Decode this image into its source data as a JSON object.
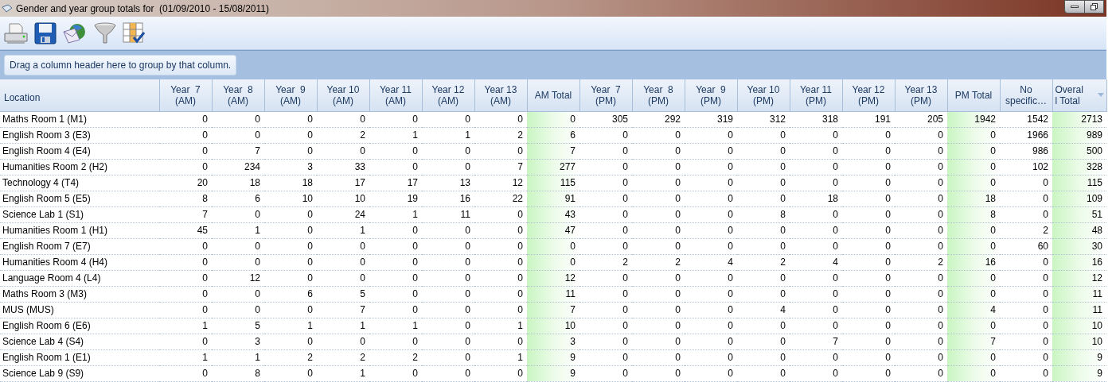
{
  "window": {
    "title": "Gender and year group totals for  (01/09/2010 - 15/08/2011)"
  },
  "toolbar": [
    {
      "kind": "print"
    },
    {
      "kind": "save"
    },
    {
      "kind": "email"
    },
    {
      "kind": "filter"
    },
    {
      "kind": "columns"
    }
  ],
  "group_panel": {
    "hint": "Drag a column header here to group by that column."
  },
  "table": {
    "columns": [
      {
        "lines": [
          "Location"
        ],
        "kind": "text"
      },
      {
        "lines": [
          "Year  7",
          "(AM)"
        ],
        "kind": "count"
      },
      {
        "lines": [
          "Year  8",
          "(AM)"
        ],
        "kind": "count"
      },
      {
        "lines": [
          "Year  9",
          "(AM)"
        ],
        "kind": "count"
      },
      {
        "lines": [
          "Year 10",
          "(AM)"
        ],
        "kind": "count"
      },
      {
        "lines": [
          "Year 11",
          "(AM)"
        ],
        "kind": "count"
      },
      {
        "lines": [
          "Year 12",
          "(AM)"
        ],
        "kind": "count"
      },
      {
        "lines": [
          "Year 13",
          "(AM)"
        ],
        "kind": "count"
      },
      {
        "lines": [
          "AM Total"
        ],
        "kind": "total"
      },
      {
        "lines": [
          "Year  7",
          "(PM)"
        ],
        "kind": "count"
      },
      {
        "lines": [
          "Year  8",
          "(PM)"
        ],
        "kind": "count"
      },
      {
        "lines": [
          "Year  9",
          "(PM)"
        ],
        "kind": "count"
      },
      {
        "lines": [
          "Year 10",
          "(PM)"
        ],
        "kind": "count"
      },
      {
        "lines": [
          "Year 11",
          "(PM)"
        ],
        "kind": "count"
      },
      {
        "lines": [
          "Year 12",
          "(PM)"
        ],
        "kind": "count"
      },
      {
        "lines": [
          "Year 13",
          "(PM)"
        ],
        "kind": "count"
      },
      {
        "lines": [
          "PM Total"
        ],
        "kind": "total"
      },
      {
        "lines": [
          "No",
          "specific…"
        ],
        "kind": "count"
      },
      {
        "lines": [
          "Overal",
          "l Total"
        ],
        "kind": "total",
        "sorted": true
      }
    ],
    "rows": [
      [
        "Maths Room 1 (M1)",
        "0",
        "0",
        "0",
        "0",
        "0",
        "0",
        "0",
        "0",
        "305",
        "292",
        "319",
        "312",
        "318",
        "191",
        "205",
        "1942",
        "1542",
        "2713"
      ],
      [
        "English Room 3 (E3)",
        "0",
        "0",
        "0",
        "2",
        "1",
        "1",
        "2",
        "6",
        "0",
        "0",
        "0",
        "0",
        "0",
        "0",
        "0",
        "0",
        "1966",
        "989"
      ],
      [
        "English Room 4 (E4)",
        "0",
        "7",
        "0",
        "0",
        "0",
        "0",
        "0",
        "7",
        "0",
        "0",
        "0",
        "0",
        "0",
        "0",
        "0",
        "0",
        "986",
        "500"
      ],
      [
        "Humanities Room 2 (H2)",
        "0",
        "234",
        "3",
        "33",
        "0",
        "0",
        "7",
        "277",
        "0",
        "0",
        "0",
        "0",
        "0",
        "0",
        "0",
        "0",
        "102",
        "328"
      ],
      [
        "Technology 4 (T4)",
        "20",
        "18",
        "18",
        "17",
        "17",
        "13",
        "12",
        "115",
        "0",
        "0",
        "0",
        "0",
        "0",
        "0",
        "0",
        "0",
        "0",
        "115"
      ],
      [
        "English Room 5 (E5)",
        "8",
        "6",
        "10",
        "10",
        "19",
        "16",
        "22",
        "91",
        "0",
        "0",
        "0",
        "0",
        "18",
        "0",
        "0",
        "18",
        "0",
        "109"
      ],
      [
        "Science Lab 1 (S1)",
        "7",
        "0",
        "0",
        "24",
        "1",
        "11",
        "0",
        "43",
        "0",
        "0",
        "0",
        "8",
        "0",
        "0",
        "0",
        "8",
        "0",
        "51"
      ],
      [
        "Humanities Room 1 (H1)",
        "45",
        "1",
        "0",
        "1",
        "0",
        "0",
        "0",
        "47",
        "0",
        "0",
        "0",
        "0",
        "0",
        "0",
        "0",
        "0",
        "2",
        "48"
      ],
      [
        "English Room 7 (E7)",
        "0",
        "0",
        "0",
        "0",
        "0",
        "0",
        "0",
        "0",
        "0",
        "0",
        "0",
        "0",
        "0",
        "0",
        "0",
        "0",
        "60",
        "30"
      ],
      [
        "Humanities Room 4 (H4)",
        "0",
        "0",
        "0",
        "0",
        "0",
        "0",
        "0",
        "0",
        "2",
        "2",
        "4",
        "2",
        "4",
        "0",
        "2",
        "16",
        "0",
        "16"
      ],
      [
        "Language Room 4 (L4)",
        "0",
        "12",
        "0",
        "0",
        "0",
        "0",
        "0",
        "12",
        "0",
        "0",
        "0",
        "0",
        "0",
        "0",
        "0",
        "0",
        "0",
        "12"
      ],
      [
        "Maths Room 3 (M3)",
        "0",
        "0",
        "6",
        "5",
        "0",
        "0",
        "0",
        "11",
        "0",
        "0",
        "0",
        "0",
        "0",
        "0",
        "0",
        "0",
        "0",
        "11"
      ],
      [
        "MUS (MUS)",
        "0",
        "0",
        "0",
        "7",
        "0",
        "0",
        "0",
        "7",
        "0",
        "0",
        "0",
        "4",
        "0",
        "0",
        "0",
        "4",
        "0",
        "11"
      ],
      [
        "English Room 6 (E6)",
        "1",
        "5",
        "1",
        "1",
        "1",
        "0",
        "1",
        "10",
        "0",
        "0",
        "0",
        "0",
        "0",
        "0",
        "0",
        "0",
        "0",
        "10"
      ],
      [
        "Science Lab 4 (S4)",
        "0",
        "3",
        "0",
        "0",
        "0",
        "0",
        "0",
        "3",
        "0",
        "0",
        "0",
        "0",
        "7",
        "0",
        "0",
        "7",
        "0",
        "10"
      ],
      [
        "English Room 1 (E1)",
        "1",
        "1",
        "2",
        "2",
        "2",
        "0",
        "1",
        "9",
        "0",
        "0",
        "0",
        "0",
        "0",
        "0",
        "0",
        "0",
        "0",
        "9"
      ],
      [
        "Science Lab 9 (S9)",
        "0",
        "8",
        "0",
        "1",
        "0",
        "0",
        "0",
        "9",
        "0",
        "0",
        "0",
        "0",
        "0",
        "0",
        "0",
        "0",
        "0",
        "9"
      ]
    ]
  }
}
